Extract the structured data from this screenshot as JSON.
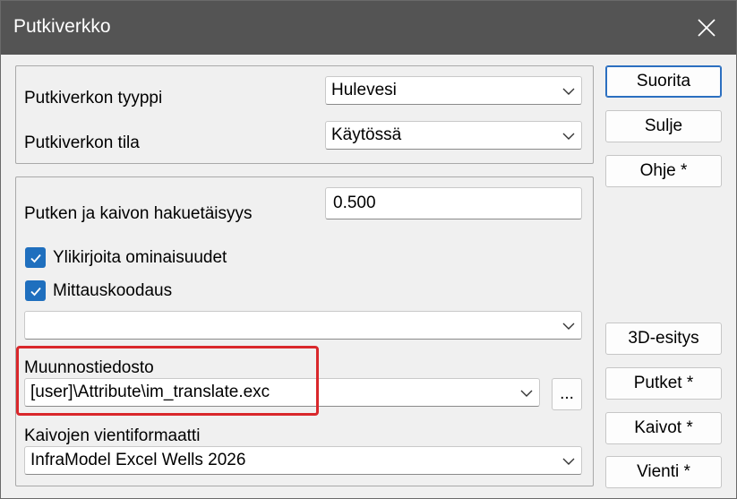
{
  "window": {
    "title": "Putkiverkko"
  },
  "network": {
    "type_label": "Putkiverkon tyyppi",
    "type_value": "Hulevesi",
    "state_label": "Putkiverkon tila",
    "state_value": "Käytössä"
  },
  "options": {
    "search_distance_label": "Putken ja kaivon hakuetäisyys",
    "search_distance_value": "0.500",
    "overwrite_label": "Ylikirjoita ominaisuudet",
    "overwrite_checked": true,
    "coding_label": "Mittauskoodaus",
    "coding_checked": true,
    "coding_value": "",
    "conversion_file_label": "Muunnostiedosto",
    "conversion_file_value": "[user]\\Attribute\\im_translate.exc",
    "browse_label": "...",
    "wells_format_label": "Kaivojen vientiformaatti",
    "wells_format_value": "InfraModel Excel Wells 2026"
  },
  "buttons": {
    "run": "Suorita",
    "close": "Sulje",
    "help": "Ohje *",
    "view3d": "3D-esitys",
    "pipes": "Putket *",
    "wells": "Kaivot *",
    "export": "Vienti *"
  },
  "colors": {
    "titlebar": "#545454",
    "accent": "#1f6fbe",
    "highlight": "#d9272b"
  }
}
